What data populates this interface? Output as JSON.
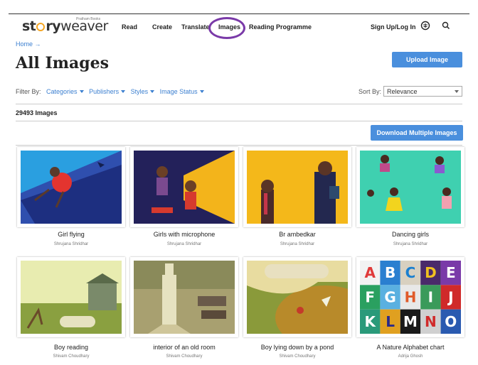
{
  "header": {
    "logo_text": "storyweaver",
    "logo_tag": "Pratham Books",
    "nav": [
      "Read",
      "Create",
      "Translate",
      "Images",
      "Reading Programme"
    ],
    "signup": "Sign Up/Log In",
    "icons": [
      "language-icon",
      "search-icon"
    ]
  },
  "breadcrumb": "Home →",
  "page_title": "All Images",
  "upload_button": "Upload Image",
  "filters": {
    "label": "Filter By:",
    "items": [
      "Categories",
      "Publishers",
      "Styles",
      "Image Status"
    ]
  },
  "sort": {
    "label": "Sort By:",
    "value": "Relevance"
  },
  "count": "29493 Images",
  "download_button": "Download Multiple Images",
  "images": [
    {
      "title": "Girl flying",
      "author": "Shrujana Shridhar"
    },
    {
      "title": "Girls with microphone",
      "author": "Shrujana Shridhar"
    },
    {
      "title": "Br ambedkar",
      "author": "Shrujana Shridhar"
    },
    {
      "title": "Dancing girls",
      "author": "Shrujana Shridhar"
    },
    {
      "title": "Boy reading",
      "author": "Shivam Choudhary"
    },
    {
      "title": "interior of an old room",
      "author": "Shivam Choudhary"
    },
    {
      "title": "Boy lying down by a pond",
      "author": "Shivam Choudhary"
    },
    {
      "title": "A Nature Alphabet chart",
      "author": "Adrija Ghosh"
    }
  ],
  "alphabet": [
    "A",
    "B",
    "C",
    "D",
    "E",
    "F",
    "G",
    "H",
    "I",
    "J",
    "K",
    "L",
    "M",
    "N",
    "O"
  ],
  "colors": {
    "accent": "#4a8fdd",
    "link": "#3b7fd0",
    "highlight_ring": "#7a3aa8"
  }
}
